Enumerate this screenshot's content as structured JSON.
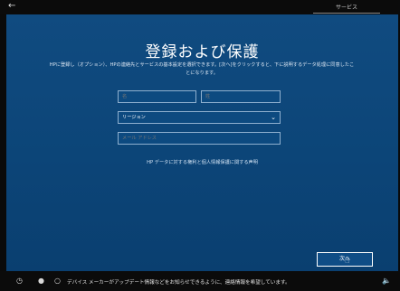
{
  "top_bar": {
    "back_icon": "back-arrow-icon",
    "tab_label": "サービス"
  },
  "main": {
    "title": "登録および保護",
    "intro": "HPに登録し（オプション）、HPの連絡先とサービスの基本設定を選択できます。[次へ]をクリックすると、下に説明するデータ処理に同意したことになります。",
    "first_name_placeholder": "名",
    "last_name_placeholder": "姓",
    "region_value": "リージョン",
    "email_placeholder": "メール アドレス",
    "privacy_link": "HP データに対する権利と個人情報保護に関する声明",
    "next_label": "次へ"
  },
  "taskbar": {
    "icons": [
      "accessibility-icon",
      "microphone-icon",
      "cortana-circle-icon",
      "speaker-icon"
    ],
    "message": "デバイス メーカーがアップデート情報などをお知らせできるように、連絡情報を希望しています。"
  }
}
